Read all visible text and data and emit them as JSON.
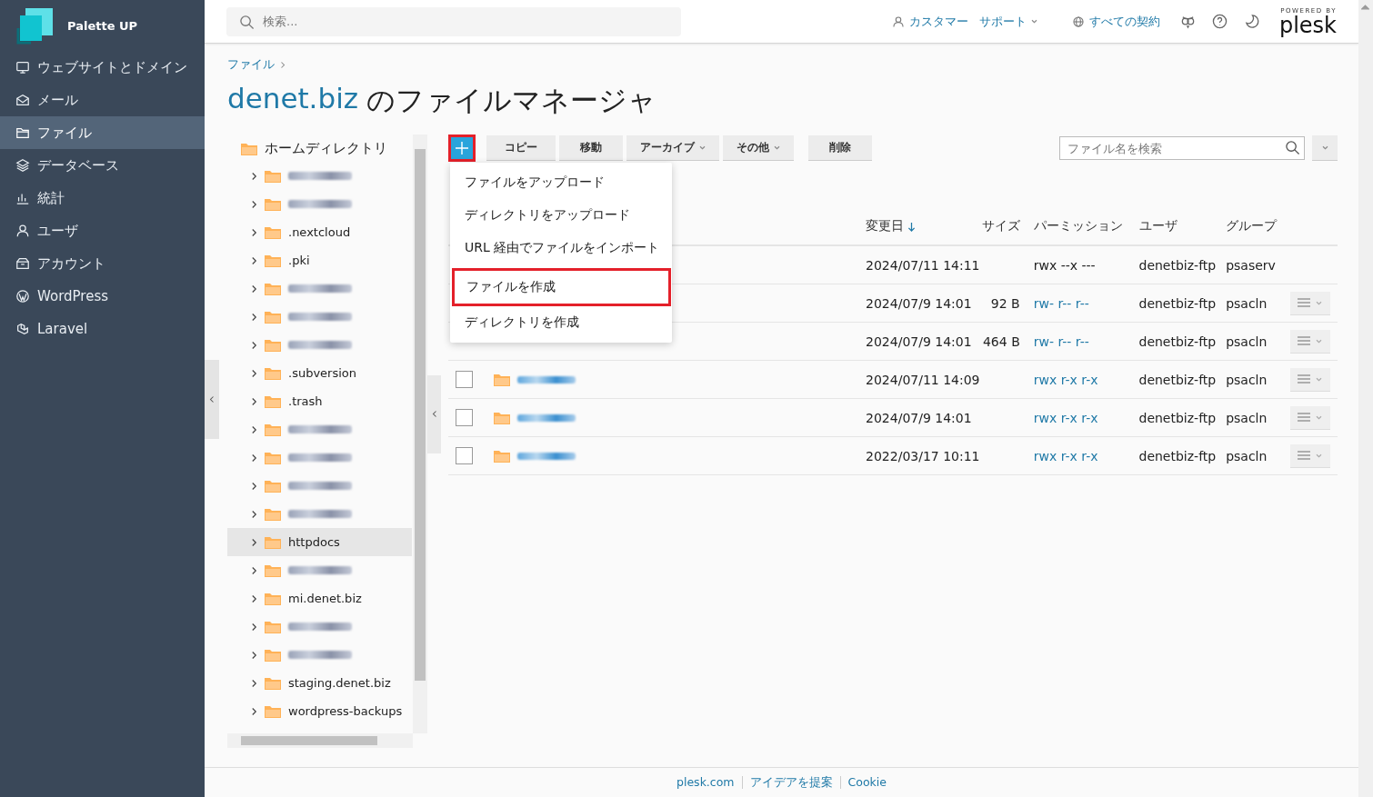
{
  "brand": {
    "name": "Palette UP"
  },
  "sidebar": {
    "items": [
      {
        "label": "ウェブサイトとドメイン",
        "selected": false
      },
      {
        "label": "メール",
        "selected": false
      },
      {
        "label": "ファイル",
        "selected": true
      },
      {
        "label": "データベース",
        "selected": false
      },
      {
        "label": "統計",
        "selected": false
      },
      {
        "label": "ユーザ",
        "selected": false
      },
      {
        "label": "アカウント",
        "selected": false
      },
      {
        "label": "WordPress",
        "selected": false
      },
      {
        "label": "Laravel",
        "selected": false
      }
    ]
  },
  "topbar": {
    "search": {
      "placeholder": "検索..."
    },
    "links": [
      {
        "label": "カスタマー",
        "dropdown": false
      },
      {
        "label": "サポート",
        "dropdown": true
      },
      {
        "label": "すべての契約",
        "dropdown": false
      }
    ],
    "powered_by": "POWERED BY",
    "logo": "plesk"
  },
  "breadcrumb": [
    "ファイル"
  ],
  "title": {
    "domain": "denet.biz",
    "text": "のファイルマネージャ"
  },
  "tree": {
    "root": "ホームディレクトリ",
    "items": [
      {
        "kind": "redacted",
        "selected": false
      },
      {
        "kind": "redacted",
        "selected": false
      },
      {
        "kind": "folder",
        "label": ".nextcloud",
        "selected": false
      },
      {
        "kind": "folder",
        "label": ".pki",
        "selected": false
      },
      {
        "kind": "redacted",
        "selected": false
      },
      {
        "kind": "redacted",
        "selected": false
      },
      {
        "kind": "redacted",
        "selected": false
      },
      {
        "kind": "folder",
        "label": ".subversion",
        "selected": false
      },
      {
        "kind": "folder",
        "label": ".trash",
        "selected": false
      },
      {
        "kind": "redacted",
        "selected": false
      },
      {
        "kind": "redacted",
        "selected": false
      },
      {
        "kind": "redacted",
        "selected": false
      },
      {
        "kind": "redacted",
        "selected": false
      },
      {
        "kind": "folder",
        "label": "httpdocs",
        "selected": true
      },
      {
        "kind": "redacted",
        "selected": false
      },
      {
        "kind": "folder",
        "label": "mi.denet.biz",
        "selected": false
      },
      {
        "kind": "redacted",
        "selected": false
      },
      {
        "kind": "redacted",
        "selected": false
      },
      {
        "kind": "folder",
        "label": "staging.denet.biz",
        "selected": false
      },
      {
        "kind": "folder",
        "label": "wordpress-backups",
        "selected": false
      }
    ]
  },
  "toolbar": {
    "add_button": {
      "highlighted": true
    },
    "buttons": [
      {
        "label": "コピー",
        "dropdown": false
      },
      {
        "label": "移動",
        "dropdown": false
      },
      {
        "label": "アーカイブ",
        "dropdown": true
      },
      {
        "label": "その他",
        "dropdown": true
      },
      {
        "label": "削除",
        "dropdown": false
      }
    ],
    "search": {
      "placeholder": "ファイル名を検索"
    }
  },
  "add_menu": {
    "items": [
      {
        "label": "ファイルをアップロード",
        "highlighted": false
      },
      {
        "label": "ディレクトリをアップロード",
        "highlighted": false
      },
      {
        "label": "URL 経由でファイルをインポート",
        "highlighted": false
      },
      {
        "label": "ファイルを作成",
        "highlighted": true
      },
      {
        "label": "ディレクトリを作成",
        "highlighted": false
      }
    ]
  },
  "table": {
    "columns": [
      {
        "label": "変更日",
        "sorted": true
      },
      {
        "label": "サイズ",
        "sorted": false
      },
      {
        "label": "パーミッション",
        "sorted": false
      },
      {
        "label": "ユーザ",
        "sorted": false
      },
      {
        "label": "グループ",
        "sorted": false
      }
    ],
    "rows": [
      {
        "kind": "covered",
        "modified": "2024/07/11 14:11",
        "permissions": "rwx --x ---",
        "permissions_link": false,
        "user": "denetbiz-ftp",
        "group": "psaserv",
        "actions": false
      },
      {
        "kind": "covered",
        "modified": "2024/07/9 14:01",
        "size": "92 B",
        "permissions": "rw- r-- r--",
        "permissions_link": true,
        "user": "denetbiz-ftp",
        "group": "psacln",
        "actions": true
      },
      {
        "kind": "covered",
        "modified": "2024/07/9 14:01",
        "size": "464 B",
        "permissions": "rw- r-- r--",
        "permissions_link": true,
        "user": "denetbiz-ftp",
        "group": "psacln",
        "actions": true
      },
      {
        "kind": "folder",
        "checked": false,
        "modified": "2024/07/11 14:09",
        "permissions": "rwx r-x r-x",
        "permissions_link": true,
        "user": "denetbiz-ftp",
        "group": "psacln",
        "actions": true
      },
      {
        "kind": "folder",
        "checked": false,
        "modified": "2024/07/9 14:01",
        "permissions": "rwx r-x r-x",
        "permissions_link": true,
        "user": "denetbiz-ftp",
        "group": "psacln",
        "actions": true
      },
      {
        "kind": "folder",
        "checked": false,
        "modified": "2022/03/17 10:11",
        "permissions": "rwx r-x r-x",
        "permissions_link": true,
        "user": "denetbiz-ftp",
        "group": "psacln",
        "actions": true
      }
    ]
  },
  "footer": {
    "links": [
      "plesk.com",
      "アイデアを提案",
      "Cookie"
    ]
  }
}
